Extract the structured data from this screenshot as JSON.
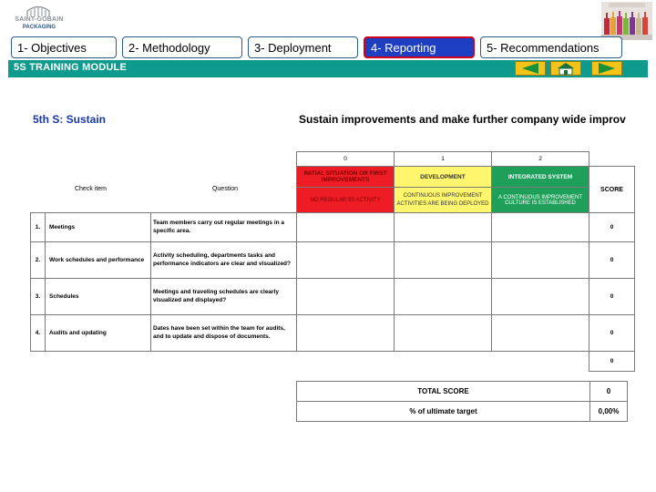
{
  "brand": {
    "name": "SAINT-GOBAIN",
    "sub": "PACKAGING"
  },
  "nav": {
    "tabs": [
      {
        "label": "1- Objectives"
      },
      {
        "label": "2- Methodology"
      },
      {
        "label": "3- Deployment"
      },
      {
        "label": "4- Reporting",
        "active": true
      },
      {
        "label": "5- Recommendations"
      }
    ]
  },
  "module": {
    "title": "5S TRAINING MODULE",
    "prev_icon": "left-arrow-icon",
    "home_icon": "home-icon",
    "next_icon": "right-arrow-icon"
  },
  "section": {
    "title": "5th S: Sustain",
    "subtitle": "Sustain improvements and make further company wide improv"
  },
  "table": {
    "check_item_header": "Check item",
    "question_header": "Question",
    "score_header": "SCORE",
    "levels": [
      {
        "number": "0",
        "name": "INITIAL SITUATION OR FIRST IMPROVEMENTS",
        "desc": "NO REGULAR 5S ACTIVITY",
        "color": "#ee1c24"
      },
      {
        "number": "1",
        "name": "DEVELOPMENT",
        "desc": "CONTINUOUS IMPROVEMENT ACTIVITIES ARE BEING DEPLOYED",
        "color": "#fff66e"
      },
      {
        "number": "2",
        "name": "INTEGRATED SYSTEM",
        "desc": "A CONTINUOUS IMPROVEMENT CULTURE IS ESTABLISHED",
        "color": "#1fa05a"
      }
    ],
    "rows": [
      {
        "num": "1.",
        "item": "Meetings",
        "question": "Team members carry out regular meetings in a specific area.",
        "score": "0"
      },
      {
        "num": "2.",
        "item": "Work schedules and performance",
        "question": "Activity scheduling, departments tasks and performance indicators are clear and visualized?",
        "score": "0"
      },
      {
        "num": "3.",
        "item": "Schedules",
        "question": "Meetings and traveling schedules are clearly visualized and displayed?",
        "score": "0"
      },
      {
        "num": "4.",
        "item": "Audits and updating",
        "question": "Dates have been set within the team for audits, and to update and dispose of documents.",
        "score": "0"
      }
    ],
    "sum_score": "0",
    "total_label": "TOTAL SCORE",
    "total_value": "0",
    "target_label": "% of ultimate target",
    "target_value": "0,00%"
  }
}
